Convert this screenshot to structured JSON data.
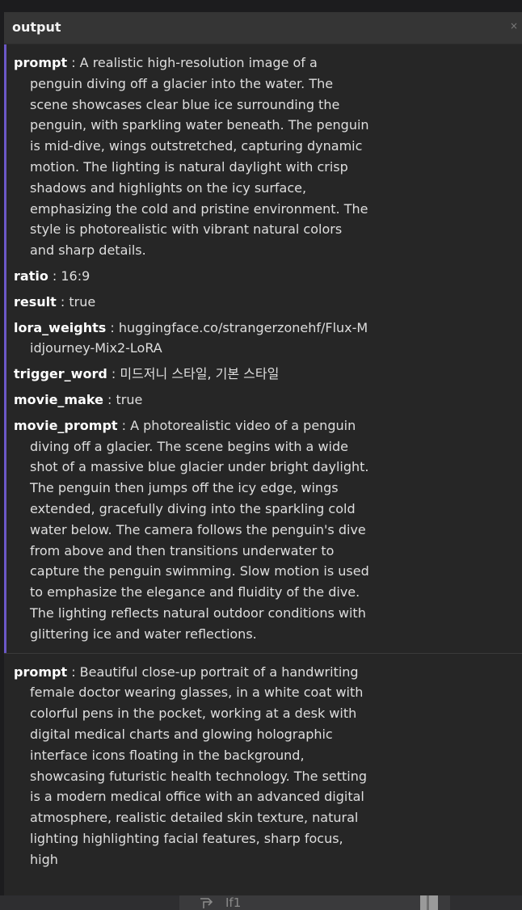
{
  "panel": {
    "title": "output",
    "close_glyph": "×"
  },
  "entries": [
    {
      "fields": [
        {
          "key": "prompt",
          "value": "A realistic high-resolution image of a penguin diving off a glacier into the water. The scene showcases clear blue ice surrounding the penguin, with sparkling water beneath. The penguin is mid-dive, wings outstretched, capturing dynamic motion. The lighting is natural daylight with crisp shadows and highlights on the icy surface, emphasizing the cold and pristine environment. The style is photorealistic with vibrant natural colors and sharp details."
        },
        {
          "key": "ratio",
          "value": "16:9"
        },
        {
          "key": "result",
          "value": "true"
        },
        {
          "key": "lora_weights",
          "value": "huggingface.co/strangerzonehf/Flux-Midjourney-Mix2-LoRA"
        },
        {
          "key": "trigger_word",
          "value": "미드저니 스타일, 기본 스타일"
        },
        {
          "key": "movie_make",
          "value": "true"
        },
        {
          "key": "movie_prompt",
          "value": "A photorealistic video of a penguin diving off a glacier. The scene begins with a wide shot of a massive blue glacier under bright daylight. The penguin then jumps off the icy edge, wings extended, gracefully diving into the sparkling cold water below. The camera follows the penguin's dive from above and then transitions underwater to capture the penguin swimming. Slow motion is used to emphasize the elegance and fluidity of the dive. The lighting reflects natural outdoor conditions with glittering ice and water reflections."
        }
      ]
    },
    {
      "fields": [
        {
          "key": "prompt",
          "value": "Beautiful close-up portrait of a handwriting female doctor wearing glasses, in a white coat with colorful pens in the pocket, working at a desk with digital medical charts and glowing holographic interface icons floating in the background, showcasing futuristic health technology. The setting is a modern medical office with an advanced digital atmosphere, realistic detailed skin texture, natural lighting highlighting facial features, sharp focus, high"
        }
      ]
    }
  ],
  "status_bar": {
    "branch_icon": "branch-icon",
    "branch_label": "If1"
  },
  "colors": {
    "accent": "#6b58c7",
    "panel_bg": "#262626",
    "header_bg": "#353535"
  }
}
